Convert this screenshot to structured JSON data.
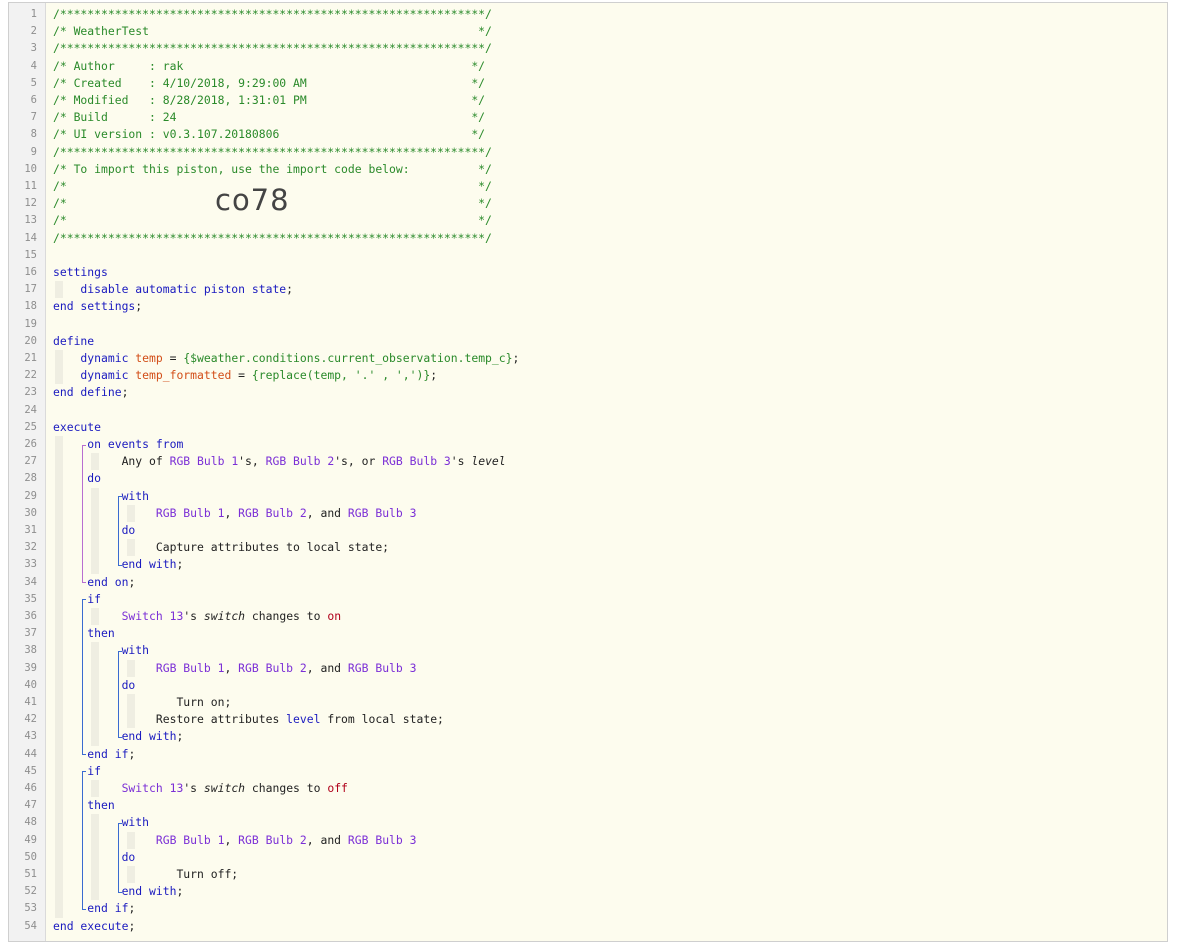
{
  "import_code": "co78",
  "lines": [
    {
      "n": "1",
      "segs": [
        {
          "t": "/**************************************************************/",
          "c": "cmt"
        }
      ]
    },
    {
      "n": "2",
      "segs": [
        {
          "t": "/* WeatherTest                                                */",
          "c": "cmt"
        }
      ]
    },
    {
      "n": "3",
      "segs": [
        {
          "t": "/**************************************************************/",
          "c": "cmt"
        }
      ]
    },
    {
      "n": "4",
      "segs": [
        {
          "t": "/* Author     : rak                                          */",
          "c": "cmt"
        }
      ]
    },
    {
      "n": "5",
      "segs": [
        {
          "t": "/* Created    : 4/10/2018, 9:29:00 AM                        */",
          "c": "cmt"
        }
      ]
    },
    {
      "n": "6",
      "segs": [
        {
          "t": "/* Modified   : 8/28/2018, 1:31:01 PM                        */",
          "c": "cmt"
        }
      ]
    },
    {
      "n": "7",
      "segs": [
        {
          "t": "/* Build      : 24                                           */",
          "c": "cmt"
        }
      ]
    },
    {
      "n": "8",
      "segs": [
        {
          "t": "/* UI version : v0.3.107.20180806                            */",
          "c": "cmt"
        }
      ]
    },
    {
      "n": "9",
      "segs": [
        {
          "t": "/**************************************************************/",
          "c": "cmt"
        }
      ]
    },
    {
      "n": "10",
      "segs": [
        {
          "t": "/* To import this piston, use the import code below:          */",
          "c": "cmt"
        }
      ]
    },
    {
      "n": "11",
      "segs": [
        {
          "t": "/*                                                            */",
          "c": "cmt"
        }
      ]
    },
    {
      "n": "12",
      "segs": [
        {
          "t": "/*                                                            */",
          "c": "cmt"
        }
      ]
    },
    {
      "n": "13",
      "segs": [
        {
          "t": "/*                                                            */",
          "c": "cmt"
        }
      ]
    },
    {
      "n": "14",
      "segs": [
        {
          "t": "/**************************************************************/",
          "c": "cmt"
        }
      ]
    },
    {
      "n": "15",
      "segs": []
    },
    {
      "n": "16",
      "segs": [
        {
          "t": "settings",
          "c": "kw"
        }
      ]
    },
    {
      "n": "17",
      "segs": [
        {
          "t": "    disable automatic piston state",
          "c": "kw"
        },
        {
          "t": ";",
          "c": ""
        }
      ]
    },
    {
      "n": "18",
      "segs": [
        {
          "t": "end settings",
          "c": "kw"
        },
        {
          "t": ";",
          "c": ""
        }
      ]
    },
    {
      "n": "19",
      "segs": []
    },
    {
      "n": "20",
      "segs": [
        {
          "t": "define",
          "c": "kw"
        }
      ]
    },
    {
      "n": "21",
      "segs": [
        {
          "t": "    dynamic ",
          "c": "kw"
        },
        {
          "t": "temp",
          "c": "var"
        },
        {
          "t": " = ",
          "c": ""
        },
        {
          "t": "{$weather.conditions.current_observation.temp_c}",
          "c": "str"
        },
        {
          "t": ";",
          "c": ""
        }
      ]
    },
    {
      "n": "22",
      "segs": [
        {
          "t": "    dynamic ",
          "c": "kw"
        },
        {
          "t": "temp_formatted",
          "c": "var"
        },
        {
          "t": " = ",
          "c": ""
        },
        {
          "t": "{replace(temp, '.' , ',')}",
          "c": "str"
        },
        {
          "t": ";",
          "c": ""
        }
      ]
    },
    {
      "n": "23",
      "segs": [
        {
          "t": "end define",
          "c": "kw"
        },
        {
          "t": ";",
          "c": ""
        }
      ]
    },
    {
      "n": "24",
      "segs": []
    },
    {
      "n": "25",
      "segs": [
        {
          "t": "execute",
          "c": "kw"
        }
      ]
    },
    {
      "n": "26",
      "segs": [
        {
          "t": "     on events from",
          "c": "kw"
        }
      ]
    },
    {
      "n": "27",
      "segs": [
        {
          "t": "          Any of ",
          "c": ""
        },
        {
          "t": "RGB Bulb 1",
          "c": "dev"
        },
        {
          "t": "'s, ",
          "c": ""
        },
        {
          "t": "RGB Bulb 2",
          "c": "dev"
        },
        {
          "t": "'s, or ",
          "c": ""
        },
        {
          "t": "RGB Bulb 3",
          "c": "dev"
        },
        {
          "t": "'s ",
          "c": ""
        },
        {
          "t": "level",
          "c": "attr"
        }
      ]
    },
    {
      "n": "28",
      "segs": [
        {
          "t": "     do",
          "c": "kw"
        }
      ]
    },
    {
      "n": "29",
      "segs": [
        {
          "t": "          with",
          "c": "kw"
        }
      ]
    },
    {
      "n": "30",
      "segs": [
        {
          "t": "               ",
          "c": ""
        },
        {
          "t": "RGB Bulb 1",
          "c": "dev"
        },
        {
          "t": ", ",
          "c": ""
        },
        {
          "t": "RGB Bulb 2",
          "c": "dev"
        },
        {
          "t": ", and ",
          "c": ""
        },
        {
          "t": "RGB Bulb 3",
          "c": "dev"
        }
      ]
    },
    {
      "n": "31",
      "segs": [
        {
          "t": "          do",
          "c": "kw"
        }
      ]
    },
    {
      "n": "32",
      "segs": [
        {
          "t": "               Capture attributes to local state;",
          "c": ""
        }
      ]
    },
    {
      "n": "33",
      "segs": [
        {
          "t": "          end with",
          "c": "kw"
        },
        {
          "t": ";",
          "c": ""
        }
      ]
    },
    {
      "n": "34",
      "segs": [
        {
          "t": "     end on",
          "c": "kw"
        },
        {
          "t": ";",
          "c": ""
        }
      ]
    },
    {
      "n": "35",
      "segs": [
        {
          "t": "     if",
          "c": "kw"
        }
      ]
    },
    {
      "n": "36",
      "segs": [
        {
          "t": "          ",
          "c": ""
        },
        {
          "t": "Switch 13",
          "c": "dev"
        },
        {
          "t": "'s ",
          "c": ""
        },
        {
          "t": "switch",
          "c": "attr"
        },
        {
          "t": " changes to ",
          "c": ""
        },
        {
          "t": "on",
          "c": "val"
        }
      ]
    },
    {
      "n": "37",
      "segs": [
        {
          "t": "     then",
          "c": "kw"
        }
      ]
    },
    {
      "n": "38",
      "segs": [
        {
          "t": "          with",
          "c": "kw"
        }
      ]
    },
    {
      "n": "39",
      "segs": [
        {
          "t": "               ",
          "c": ""
        },
        {
          "t": "RGB Bulb 1",
          "c": "dev"
        },
        {
          "t": ", ",
          "c": ""
        },
        {
          "t": "RGB Bulb 2",
          "c": "dev"
        },
        {
          "t": ", and ",
          "c": ""
        },
        {
          "t": "RGB Bulb 3",
          "c": "dev"
        }
      ]
    },
    {
      "n": "40",
      "segs": [
        {
          "t": "          do",
          "c": "kw"
        }
      ]
    },
    {
      "n": "41",
      "segs": [
        {
          "t": "                  Turn on;",
          "c": ""
        }
      ]
    },
    {
      "n": "42",
      "segs": [
        {
          "t": "               Restore attributes ",
          "c": ""
        },
        {
          "t": "level",
          "c": "lvl"
        },
        {
          "t": " from local state;",
          "c": ""
        }
      ]
    },
    {
      "n": "43",
      "segs": [
        {
          "t": "          end with",
          "c": "kw"
        },
        {
          "t": ";",
          "c": ""
        }
      ]
    },
    {
      "n": "44",
      "segs": [
        {
          "t": "     end if",
          "c": "kw"
        },
        {
          "t": ";",
          "c": ""
        }
      ]
    },
    {
      "n": "45",
      "segs": [
        {
          "t": "     if",
          "c": "kw"
        }
      ]
    },
    {
      "n": "46",
      "segs": [
        {
          "t": "          ",
          "c": ""
        },
        {
          "t": "Switch 13",
          "c": "dev"
        },
        {
          "t": "'s ",
          "c": ""
        },
        {
          "t": "switch",
          "c": "attr"
        },
        {
          "t": " changes to ",
          "c": ""
        },
        {
          "t": "off",
          "c": "val"
        }
      ]
    },
    {
      "n": "47",
      "segs": [
        {
          "t": "     then",
          "c": "kw"
        }
      ]
    },
    {
      "n": "48",
      "segs": [
        {
          "t": "          with",
          "c": "kw"
        }
      ]
    },
    {
      "n": "49",
      "segs": [
        {
          "t": "               ",
          "c": ""
        },
        {
          "t": "RGB Bulb 1",
          "c": "dev"
        },
        {
          "t": ", ",
          "c": ""
        },
        {
          "t": "RGB Bulb 2",
          "c": "dev"
        },
        {
          "t": ", and ",
          "c": ""
        },
        {
          "t": "RGB Bulb 3",
          "c": "dev"
        }
      ]
    },
    {
      "n": "50",
      "segs": [
        {
          "t": "          do",
          "c": "kw"
        }
      ]
    },
    {
      "n": "51",
      "segs": [
        {
          "t": "                  Turn off;",
          "c": ""
        }
      ]
    },
    {
      "n": "52",
      "segs": [
        {
          "t": "          end with",
          "c": "kw"
        },
        {
          "t": ";",
          "c": ""
        }
      ]
    },
    {
      "n": "53",
      "segs": [
        {
          "t": "     end if",
          "c": "kw"
        },
        {
          "t": ";",
          "c": ""
        }
      ]
    },
    {
      "n": "54",
      "segs": [
        {
          "t": "end execute",
          "c": "kw"
        },
        {
          "t": ";",
          "c": ""
        }
      ]
    }
  ]
}
